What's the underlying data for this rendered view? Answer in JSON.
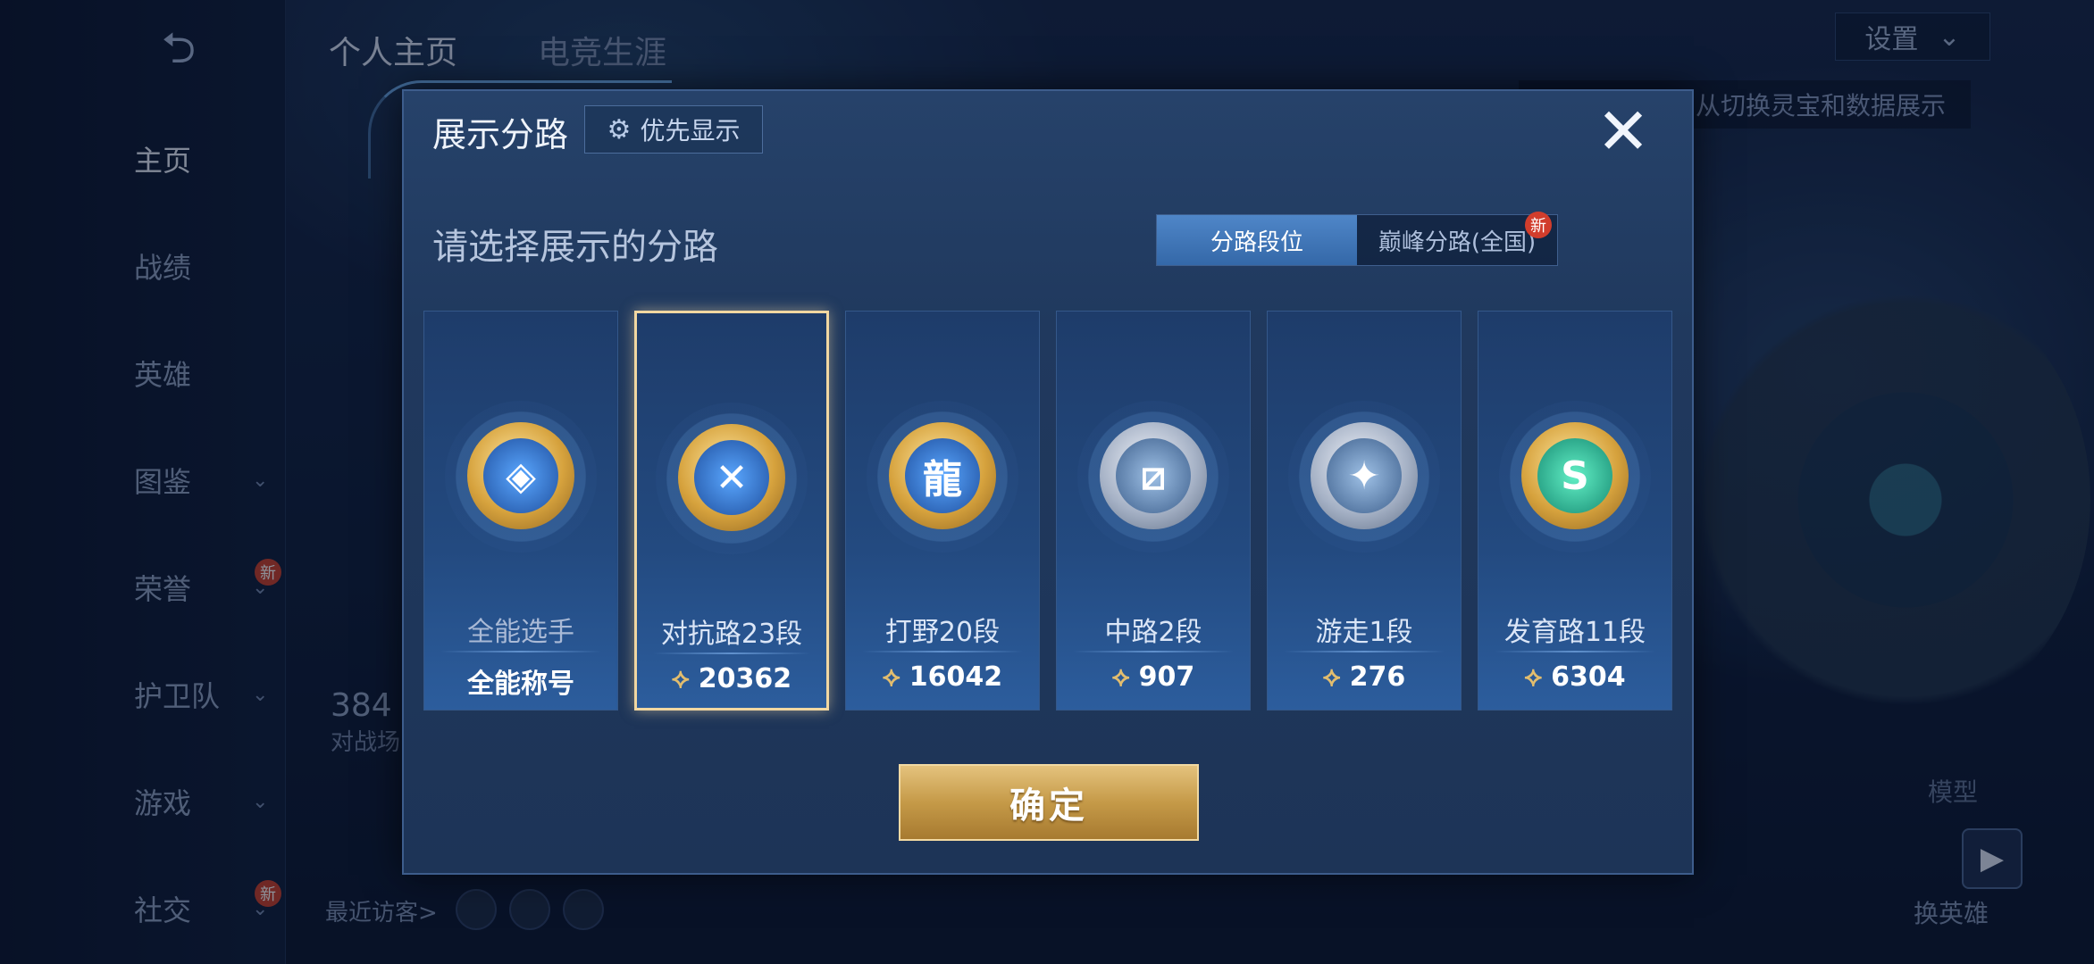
{
  "background": {
    "back_icon": "back-arrow-icon",
    "top_tabs": [
      "个人主页",
      "电竞生涯"
    ],
    "settings_label": "设置",
    "hint_text": "从切换灵宝和数据展示",
    "sidebar": [
      {
        "label": "主页",
        "active": true,
        "chevron": false,
        "new": false
      },
      {
        "label": "战绩",
        "active": false,
        "chevron": false,
        "new": false
      },
      {
        "label": "英雄",
        "active": false,
        "chevron": false,
        "new": false
      },
      {
        "label": "图鉴",
        "active": false,
        "chevron": true,
        "new": false
      },
      {
        "label": "荣誉",
        "active": false,
        "chevron": true,
        "new": true
      },
      {
        "label": "护卫队",
        "active": false,
        "chevron": true,
        "new": false
      },
      {
        "label": "游戏",
        "active": false,
        "chevron": true,
        "new": false
      },
      {
        "label": "社交",
        "active": false,
        "chevron": true,
        "new": true
      }
    ],
    "new_badge": "新",
    "stats_number": "384",
    "stats_label": "对战场",
    "visitors_label": "最近访客>",
    "model_label": "模型",
    "swap_label": "换英雄",
    "video_icon": "video-camera-icon"
  },
  "modal": {
    "title": "展示分路",
    "priority_label": "优先显示",
    "close_symbol": "✕",
    "subtitle": "请选择展示的分路",
    "segments": [
      {
        "label": "分路段位",
        "active": true,
        "new": false
      },
      {
        "label": "巅峰分路(全国)",
        "active": false,
        "new": true
      }
    ],
    "new_badge": "新",
    "cards": [
      {
        "name": "全能选手",
        "score": "全能称号",
        "show_icon": false,
        "emblem": "gold",
        "inner": "blue",
        "glyph": "◈",
        "selected": false,
        "dim": true
      },
      {
        "name": "对抗路23段",
        "score": "20362",
        "show_icon": true,
        "emblem": "gold",
        "inner": "blue",
        "glyph": "✕",
        "selected": true,
        "dim": false
      },
      {
        "name": "打野20段",
        "score": "16042",
        "show_icon": true,
        "emblem": "gold",
        "inner": "blue",
        "glyph": "龍",
        "selected": false,
        "dim": false
      },
      {
        "name": "中路2段",
        "score": "907",
        "show_icon": true,
        "emblem": "silver",
        "inner": "steel",
        "glyph": "⧄",
        "selected": false,
        "dim": false
      },
      {
        "name": "游走1段",
        "score": "276",
        "show_icon": true,
        "emblem": "silver",
        "inner": "steel",
        "glyph": "✦",
        "selected": false,
        "dim": false
      },
      {
        "name": "发育路11段",
        "score": "6304",
        "show_icon": true,
        "emblem": "gold",
        "inner": "green",
        "glyph": "S",
        "selected": false,
        "dim": false
      }
    ],
    "score_icon": "peak-points-icon",
    "confirm_label": "确定"
  },
  "colors": {
    "accent_gold": "#e4c27d",
    "selected_border": "#f1d7a1",
    "segment_active": "#4f86c8",
    "new_badge": "#d13d2c"
  }
}
